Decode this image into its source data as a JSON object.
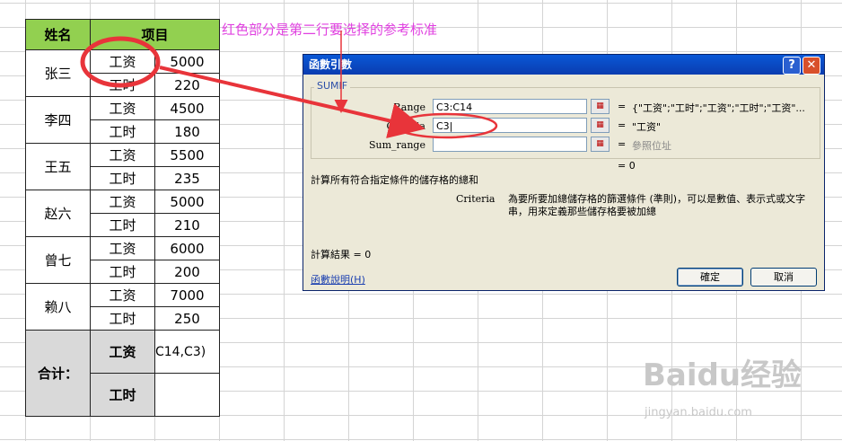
{
  "annotation": "红色部分是第二行要选择的参考标准",
  "sheet": {
    "headers": [
      "姓名",
      "项目"
    ],
    "people": [
      {
        "name": "张三",
        "rows": [
          [
            "工资",
            "5000"
          ],
          [
            "工时",
            "220"
          ]
        ]
      },
      {
        "name": "李四",
        "rows": [
          [
            "工资",
            "4500"
          ],
          [
            "工时",
            "180"
          ]
        ]
      },
      {
        "name": "王五",
        "rows": [
          [
            "工资",
            "5500"
          ],
          [
            "工时",
            "235"
          ]
        ]
      },
      {
        "name": "赵六",
        "rows": [
          [
            "工资",
            "5000"
          ],
          [
            "工时",
            "210"
          ]
        ]
      },
      {
        "name": "曾七",
        "rows": [
          [
            "工资",
            "6000"
          ],
          [
            "工时",
            "200"
          ]
        ]
      },
      {
        "name": "赖八",
        "rows": [
          [
            "工资",
            "7000"
          ],
          [
            "工时",
            "250"
          ]
        ]
      }
    ],
    "total_label": "合计：",
    "total_items": [
      "工资",
      "工时"
    ],
    "formula_text": "C14,C3)"
  },
  "dialog": {
    "title": "函數引數",
    "help_btn": "?",
    "close_btn": "✕",
    "function_name": "SUMIF",
    "args": [
      {
        "label": "Range",
        "value": "C3:C14",
        "result": "{\"工资\";\"工时\";\"工资\";\"工时\";\"工资\"..."
      },
      {
        "label": "Criteria",
        "value": "C3|",
        "result": "\"工资\""
      },
      {
        "label": "Sum_range",
        "value": "",
        "result": "參照位址"
      }
    ],
    "eq": "=",
    "formula_result_line": "= 0",
    "description": "計算所有符合指定條件的儲存格的總和",
    "arg_name": "Criteria",
    "arg_description": "為要所要加總儲存格的篩選條件 (準則)，可以是數值、表示式或文字串，用來定義那些儲存格要被加總",
    "calc_result": "計算結果 =    0",
    "help_link": "函數說明(H)",
    "ok": "確定",
    "cancel": "取消"
  },
  "watermark": {
    "brand": "Baidu经验",
    "url": "jingyan.baidu.com"
  },
  "colors": {
    "header_green": "#92d050",
    "total_gray": "#d9d9d9",
    "annotation_magenta": "#e040e0",
    "marker_red": "#e8343a"
  }
}
